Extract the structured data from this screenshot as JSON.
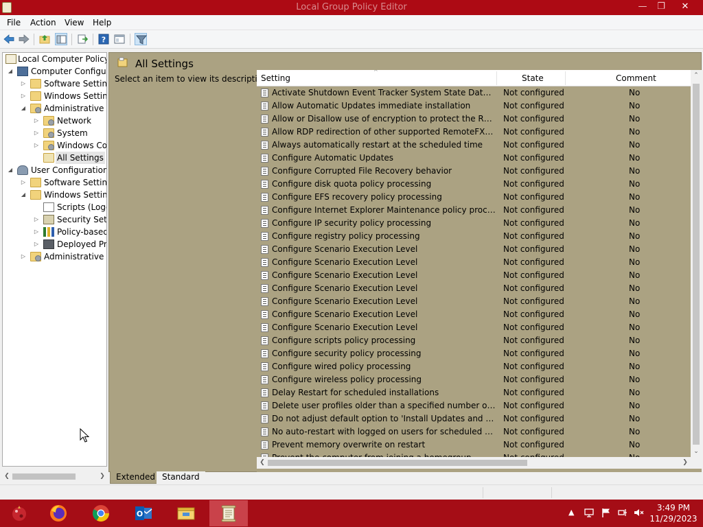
{
  "window": {
    "title": "Local Group Policy Editor",
    "min": "—",
    "max": "❐",
    "close": "✕"
  },
  "menu": [
    "File",
    "Action",
    "View",
    "Help"
  ],
  "tree": {
    "items": [
      {
        "label": "Local Computer Policy",
        "level": 0,
        "exp": "",
        "icon": "policy-icon"
      },
      {
        "label": "Computer Configuration",
        "level": 1,
        "exp": "◢",
        "icon": "computer-icon"
      },
      {
        "label": "Software Settings",
        "level": 2,
        "exp": "▷",
        "icon": "folder-icon"
      },
      {
        "label": "Windows Settings",
        "level": 2,
        "exp": "▷",
        "icon": "folder-icon"
      },
      {
        "label": "Administrative Templates",
        "level": 2,
        "exp": "◢",
        "icon": "folder-gear-icon"
      },
      {
        "label": "Network",
        "level": 3,
        "exp": "▷",
        "icon": "folder-gear-icon"
      },
      {
        "label": "System",
        "level": 3,
        "exp": "▷",
        "icon": "folder-gear-icon"
      },
      {
        "label": "Windows Components",
        "level": 3,
        "exp": "▷",
        "icon": "folder-gear-icon"
      },
      {
        "label": "All Settings",
        "level": 3,
        "exp": "",
        "icon": "all-settings-icon",
        "selected": true
      },
      {
        "label": "User Configuration",
        "level": 1,
        "exp": "◢",
        "icon": "user-icon"
      },
      {
        "label": "Software Settings",
        "level": 2,
        "exp": "▷",
        "icon": "folder-icon"
      },
      {
        "label": "Windows Settings",
        "level": 2,
        "exp": "◢",
        "icon": "folder-icon"
      },
      {
        "label": "Scripts (Logon/Logoff)",
        "level": 3,
        "exp": "",
        "icon": "scripts-icon"
      },
      {
        "label": "Security Settings",
        "level": 3,
        "exp": "▷",
        "icon": "security-icon"
      },
      {
        "label": "Policy-based QoS",
        "level": 3,
        "exp": "▷",
        "icon": "chart-icon"
      },
      {
        "label": "Deployed Printers",
        "level": 3,
        "exp": "▷",
        "icon": "printer-icon"
      },
      {
        "label": "Administrative Templates",
        "level": 2,
        "exp": "▷",
        "icon": "folder-gear-icon"
      }
    ]
  },
  "panel": {
    "title": "All Settings",
    "description": "Select an item to view its description.",
    "columns": {
      "setting": "Setting",
      "state": "State",
      "comment": "Comment"
    },
    "rows": [
      {
        "setting": "Activate Shutdown Event Tracker System State Data feature",
        "state": "Not configured",
        "comment": "No"
      },
      {
        "setting": "Allow Automatic Updates immediate installation",
        "state": "Not configured",
        "comment": "No"
      },
      {
        "setting": "Allow or Disallow use of encryption to protect the RPC protocol messages",
        "state": "Not configured",
        "comment": "No"
      },
      {
        "setting": "Allow RDP redirection of other supported RemoteFX USB devices",
        "state": "Not configured",
        "comment": "No"
      },
      {
        "setting": "Always automatically restart at the scheduled time",
        "state": "Not configured",
        "comment": "No"
      },
      {
        "setting": "Configure Automatic Updates",
        "state": "Not configured",
        "comment": "No"
      },
      {
        "setting": "Configure Corrupted File Recovery behavior",
        "state": "Not configured",
        "comment": "No"
      },
      {
        "setting": "Configure disk quota policy processing",
        "state": "Not configured",
        "comment": "No"
      },
      {
        "setting": "Configure EFS recovery policy processing",
        "state": "Not configured",
        "comment": "No"
      },
      {
        "setting": "Configure Internet Explorer Maintenance policy processing",
        "state": "Not configured",
        "comment": "No"
      },
      {
        "setting": "Configure IP security policy processing",
        "state": "Not configured",
        "comment": "No"
      },
      {
        "setting": "Configure registry policy processing",
        "state": "Not configured",
        "comment": "No"
      },
      {
        "setting": "Configure Scenario Execution Level",
        "state": "Not configured",
        "comment": "No"
      },
      {
        "setting": "Configure Scenario Execution Level",
        "state": "Not configured",
        "comment": "No"
      },
      {
        "setting": "Configure Scenario Execution Level",
        "state": "Not configured",
        "comment": "No"
      },
      {
        "setting": "Configure Scenario Execution Level",
        "state": "Not configured",
        "comment": "No"
      },
      {
        "setting": "Configure Scenario Execution Level",
        "state": "Not configured",
        "comment": "No"
      },
      {
        "setting": "Configure Scenario Execution Level",
        "state": "Not configured",
        "comment": "No"
      },
      {
        "setting": "Configure Scenario Execution Level",
        "state": "Not configured",
        "comment": "No"
      },
      {
        "setting": "Configure scripts policy processing",
        "state": "Not configured",
        "comment": "No"
      },
      {
        "setting": "Configure security policy processing",
        "state": "Not configured",
        "comment": "No"
      },
      {
        "setting": "Configure wired policy processing",
        "state": "Not configured",
        "comment": "No"
      },
      {
        "setting": "Configure wireless policy processing",
        "state": "Not configured",
        "comment": "No"
      },
      {
        "setting": "Delay Restart for scheduled installations",
        "state": "Not configured",
        "comment": "No"
      },
      {
        "setting": "Delete user profiles older than a specified number of days on system restart",
        "state": "Not configured",
        "comment": "No"
      },
      {
        "setting": "Do not adjust default option to 'Install Updates and Shut Down' in Shut Down Windows dialog box",
        "state": "Not configured",
        "comment": "No"
      },
      {
        "setting": "No auto-restart with logged on users for scheduled automatic updates installations",
        "state": "Not configured",
        "comment": "No"
      },
      {
        "setting": "Prevent memory overwrite on restart",
        "state": "Not configured",
        "comment": "No"
      },
      {
        "setting": "Prevent the computer from joining a homegroup",
        "state": "Not configured",
        "comment": "No"
      }
    ]
  },
  "tabs": [
    "Extended",
    "Standard"
  ],
  "clock": {
    "time": "3:49 PM",
    "date": "11/29/2023"
  },
  "colors": {
    "titlebar": "#ad0a14",
    "taskbar": "#a50d16",
    "panel": "#aba282"
  }
}
